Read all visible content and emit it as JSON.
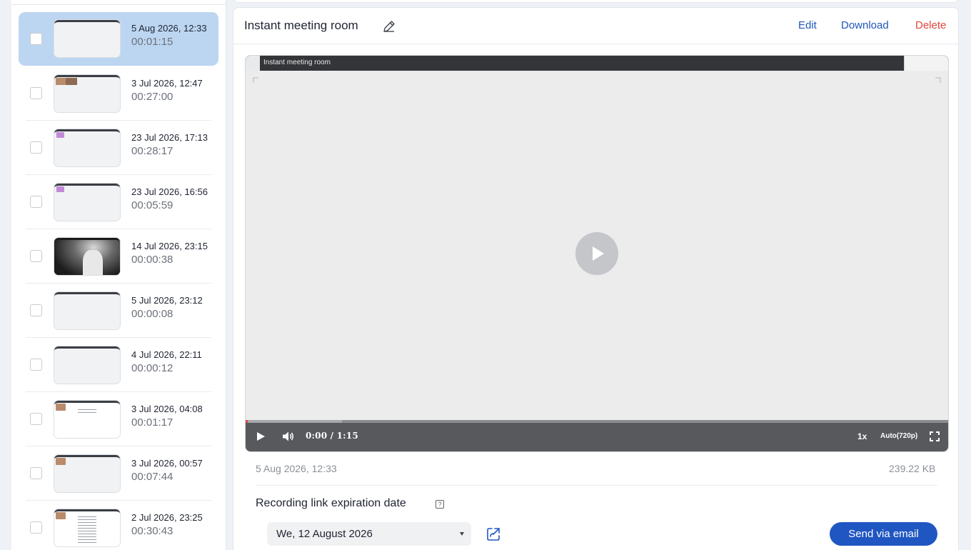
{
  "recordings": [
    {
      "date": "5 Aug 2026, 12:33",
      "duration": "00:01:15",
      "selected": true
    },
    {
      "date": "3 Jul 2026, 12:47",
      "duration": "00:27:00"
    },
    {
      "date": "23 Jul 2026, 17:13",
      "duration": "00:28:17"
    },
    {
      "date": "23 Jul 2026, 16:56",
      "duration": "00:05:59"
    },
    {
      "date": "14 Jul 2026, 23:15",
      "duration": "00:00:38"
    },
    {
      "date": "5 Jul 2026, 23:12",
      "duration": "00:00:08"
    },
    {
      "date": "4 Jul 2026, 22:11",
      "duration": "00:00:12"
    },
    {
      "date": "3 Jul 2026, 04:08",
      "duration": "00:01:17"
    },
    {
      "date": "3 Jul 2026, 00:57",
      "duration": "00:07:44"
    },
    {
      "date": "2 Jul 2026, 23:25",
      "duration": "00:30:43"
    }
  ],
  "detail": {
    "title": "Instant meeting room",
    "actions": {
      "edit": "Edit",
      "download": "Download",
      "delete": "Delete"
    },
    "player": {
      "frame_title": "Instant meeting room",
      "time": "0:00 / 1:15",
      "speed": "1x",
      "quality": "Auto(720p)",
      "progress_fraction": 0.0
    },
    "recorded_at": "5 Aug 2026, 12:33",
    "file_size": "239.22 KB",
    "expiry": {
      "label": "Recording link expiration date",
      "help": "?",
      "selected_date": "We, 12 August 2026"
    },
    "send_button": "Send via email"
  },
  "colors": {
    "accent": "#1f56c2",
    "selected_row": "#bcd6f1",
    "danger": "#e2443c",
    "link": "#1f56b8"
  }
}
